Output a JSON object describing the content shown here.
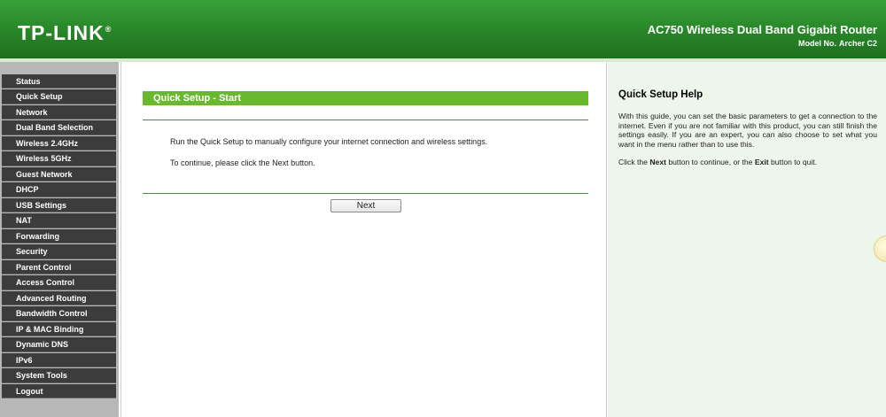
{
  "header": {
    "logo_text": "TP-LINK",
    "logo_reg": "®",
    "product_name": "AC750 Wireless Dual Band Gigabit Router",
    "model_label": "Model No.",
    "model_value": "Archer C2"
  },
  "sidebar": {
    "items": [
      {
        "label": "Status"
      },
      {
        "label": "Quick Setup"
      },
      {
        "label": "Network"
      },
      {
        "label": "Dual Band Selection"
      },
      {
        "label": "Wireless 2.4GHz"
      },
      {
        "label": "Wireless 5GHz"
      },
      {
        "label": "Guest Network"
      },
      {
        "label": "DHCP"
      },
      {
        "label": "USB Settings"
      },
      {
        "label": "NAT"
      },
      {
        "label": "Forwarding"
      },
      {
        "label": "Security"
      },
      {
        "label": "Parent Control"
      },
      {
        "label": "Access Control"
      },
      {
        "label": "Advanced Routing"
      },
      {
        "label": "Bandwidth Control"
      },
      {
        "label": "IP & MAC Binding"
      },
      {
        "label": "Dynamic DNS"
      },
      {
        "label": "IPv6"
      },
      {
        "label": "System Tools"
      },
      {
        "label": "Logout"
      }
    ]
  },
  "main": {
    "title": "Quick Setup - Start",
    "paragraph1": "Run the Quick Setup to manually configure your internet connection and wireless settings.",
    "paragraph2": "To continue, please click the Next button.",
    "next_label": "Next"
  },
  "help": {
    "title": "Quick Setup Help",
    "body": "With this guide, you can set the basic parameters to get a connection to the internet. Even if you are not familiar with this product, you can still finish the settings easily. If you are an expert, you can also choose to set what you want in the menu rather than to use this.",
    "click_the": "Click the",
    "next_word": "Next",
    "button_to_continue": "button to continue, or the",
    "exit_word": "Exit",
    "button_to_quit": "button to quit."
  },
  "colors": {
    "header_green": "#2a8a2a",
    "title_bar_green": "#6ab82e",
    "menu_bg": "#3c3c3c",
    "help_bg": "#eef5ea"
  }
}
